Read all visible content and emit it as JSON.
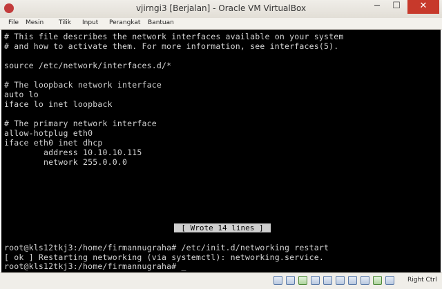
{
  "window": {
    "title": "vjirngi3 [Berjalan] - Oracle VM VirtualBox",
    "min": "─",
    "max": "☐",
    "close": "✕"
  },
  "menu": [
    "File",
    "Mesin",
    "Tilik",
    "Input",
    "Perangkat",
    "Bantuan"
  ],
  "terminal": {
    "lines": [
      "# This file describes the network interfaces available on your system",
      "# and how to activate them. For more information, see interfaces(5).",
      "",
      "source /etc/network/interfaces.d/*",
      "",
      "# The loopback network interface",
      "auto lo",
      "iface lo inet loopback",
      "",
      "# The primary network interface",
      "allow-hotplug eth0",
      "iface eth0 inet dhcp",
      "        address 10.10.10.115",
      "        network 255.0.0.0"
    ],
    "nano_status": "[ Wrote 14 lines ]",
    "shell_lines": [
      "root@kls12tkj3:/home/firmannugraha# /etc/init.d/networking restart",
      "[ ok ] Restarting networking (via systemctl): networking.service.",
      "root@kls12tkj3:/home/firmannugraha# _"
    ]
  },
  "statusbar": {
    "host_key": "Right Ctrl",
    "icons": [
      "hard-disk-icon",
      "optical-drive-icon",
      "audio-icon",
      "network-icon",
      "usb-icon",
      "shared-folder-icon",
      "display-icon",
      "video-capture-icon",
      "mouse-integration-icon",
      "keyboard-icon"
    ]
  }
}
